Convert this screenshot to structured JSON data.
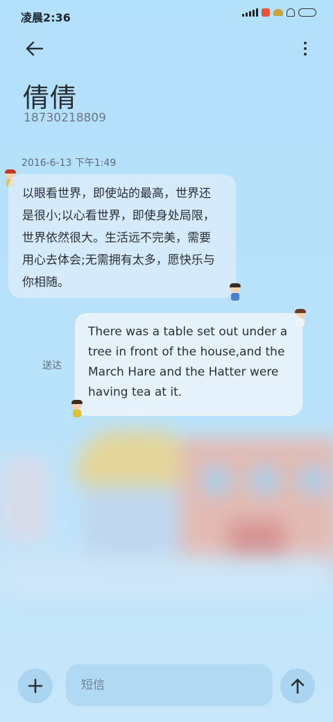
{
  "status_bar": {
    "time": "凌晨2:36"
  },
  "header": {
    "contact_name": "倩倩",
    "contact_number": "18730218809"
  },
  "conversation": {
    "timestamp": "2016-6-13 下午1:49",
    "incoming_message": "以眼看世界，即使站的最高，世界还是很小;以心看世界，即使身处局限，世界依然很大。生活远不完美，需要用心去体会;无需拥有太多，愿快乐与你相随。",
    "outgoing_message": "There was a table set out under a tree in front of the house,and the March Hare and the Hatter were having tea at it.",
    "sent_status": "送达"
  },
  "composer": {
    "placeholder": "短信"
  },
  "icons": {
    "back": "back-arrow-icon",
    "more": "more-vertical-icon",
    "add": "plus-icon",
    "send": "send-arrow-icon"
  }
}
